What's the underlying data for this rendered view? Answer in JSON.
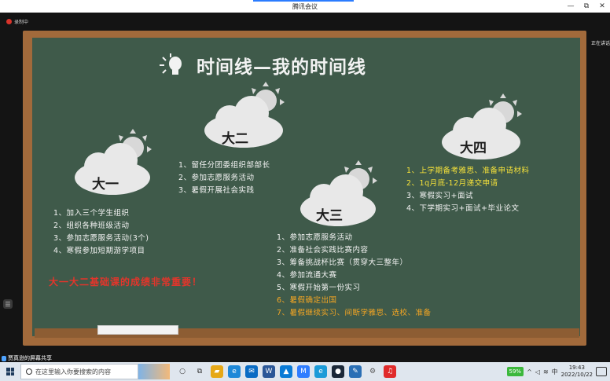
{
  "window": {
    "title": "腾讯会议",
    "controls": [
      "—",
      "⧉",
      "✕"
    ]
  },
  "meeting": {
    "recording_label": "录制中",
    "speaking_label": "正在讲话",
    "share_label": "贾真逊的屏幕共享",
    "side_handle": "☰"
  },
  "slide": {
    "title": "时间线—我的时间线",
    "years": [
      {
        "label": "大一",
        "items": [
          "1、加入三个学生组织",
          "2、组织各种班级活动",
          "3、参加志愿服务活动(3个)",
          "4、寒假参加短期游学项目"
        ]
      },
      {
        "label": "大二",
        "items": [
          "1、留任分团委组织部部长",
          "2、参加志愿服务活动",
          "3、暑假开展社会实践"
        ]
      },
      {
        "label": "大三",
        "items": [
          "1、参加志愿服务活动",
          "2、准备社会实践比赛内容",
          "3、筹备挑战杯比赛（贯穿大三整年）",
          "4、参加流通大赛",
          "5、寒假开始第一份实习",
          "6、暑假确定出国",
          "7、暑假继续实习、间断学雅思、选校、准备"
        ]
      },
      {
        "label": "大四",
        "items": [
          "1、上学期备考雅思、准备申请材料",
          "2、1q月底-12月递交申请",
          "3、寒假实习+面试",
          "4、下学期实习+面试+毕业论文"
        ]
      }
    ],
    "note": "大一大二基础课的成绩非常重要！"
  },
  "taskbar": {
    "search_placeholder": "在这里输入你要搜索的内容",
    "battery": "59%",
    "ime": "中",
    "time": "19:43",
    "date": "2022/10/22",
    "apps": [
      {
        "name": "cortana-icon",
        "glyph": "○",
        "color": "#333333"
      },
      {
        "name": "task-view-icon",
        "glyph": "⧉",
        "color": "#333333"
      },
      {
        "name": "file-explorer-icon",
        "glyph": "▰",
        "color": "#e6a817"
      },
      {
        "name": "edge-icon",
        "glyph": "e",
        "color": "#1e88d8"
      },
      {
        "name": "mail-icon",
        "glyph": "✉",
        "color": "#0a6cc4"
      },
      {
        "name": "word-icon",
        "glyph": "W",
        "color": "#2b5797"
      },
      {
        "name": "photos-icon",
        "glyph": "▲",
        "color": "#0a7bd6"
      },
      {
        "name": "tencent-meeting-icon",
        "glyph": "M",
        "color": "#2f7dff"
      },
      {
        "name": "browser-icon",
        "glyph": "e",
        "color": "#1b9bd8"
      },
      {
        "name": "steam-icon",
        "glyph": "●",
        "color": "#1b2838"
      },
      {
        "name": "stylus-icon",
        "glyph": "✎",
        "color": "#2a6fb5"
      },
      {
        "name": "settings-icon",
        "glyph": "⚙",
        "color": "#555555"
      },
      {
        "name": "netease-music-icon",
        "glyph": "♫",
        "color": "#e02b2b"
      }
    ]
  }
}
